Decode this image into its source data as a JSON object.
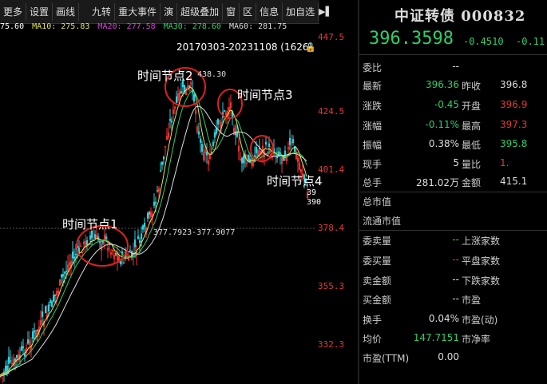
{
  "toolbar": {
    "items": [
      "更多",
      "设置",
      "画线",
      "九转",
      "重大事件",
      "演",
      "超级叠加",
      "窗",
      "区",
      "信息",
      "加自选"
    ],
    "arrow_icon": "play-forward-icon"
  },
  "ma_bar": {
    "first": "75.60",
    "ma10": "MA10: 275.83",
    "ma20": "MA20: 277.58",
    "ma30": "MA30: 278.60",
    "ma60": "MA60: 281.75",
    "colors": {
      "first": "#ffffff",
      "ma10": "#e8e84a",
      "ma20": "#e040e0",
      "ma30": "#2fcf6a",
      "ma60": "#dddddd"
    }
  },
  "chart": {
    "range": "20170303-20231108 (1626)",
    "lock_icon": "lock-icon",
    "price_ticks": [
      "447.5",
      "424.5",
      "401.4",
      "378.4",
      "355.3",
      "332.3"
    ],
    "annotations": [
      "时间节点1",
      "时间节点2",
      "时间节点3",
      "时间节点4"
    ],
    "high_label": "438.30",
    "band_label": "377.7923-377.9077",
    "end_labels": [
      "39",
      "390"
    ]
  },
  "panel": {
    "title": "中证转债 000832",
    "price": "396.3598",
    "change": "-0.4510",
    "change_pct": "-0.11",
    "rows": [
      {
        "l1": "委比",
        "v1": "--",
        "c1": "white",
        "l2": "",
        "v2": "",
        "c2": "white"
      },
      {
        "l1": "最新",
        "v1": "396.36",
        "c1": "green",
        "l2": "昨收",
        "v2": "396.8",
        "c2": "white"
      },
      {
        "l1": "涨跌",
        "v1": "-0.45",
        "c1": "green",
        "l2": "开盘",
        "v2": "396.9",
        "c2": "red"
      },
      {
        "l1": "涨幅",
        "v1": "-0.11%",
        "c1": "green",
        "l2": "最高",
        "v2": "397.3",
        "c2": "red"
      },
      {
        "l1": "振幅",
        "v1": "0.38%",
        "c1": "white",
        "l2": "最低",
        "v2": "395.8",
        "c2": "green"
      },
      {
        "l1": "现手",
        "v1": "5",
        "c1": "white",
        "l2": "量比",
        "v2": "1.",
        "c2": "red"
      },
      {
        "l1": "总手",
        "v1": "281.02万",
        "c1": "white",
        "l2": "金额",
        "v2": "415.1",
        "c2": "white"
      },
      {
        "l1": "总市值",
        "v1": "",
        "c1": "white",
        "l2": "",
        "v2": "",
        "c2": "white"
      },
      {
        "l1": "流通市值",
        "v1": "",
        "c1": "white",
        "l2": "",
        "v2": "",
        "c2": "white"
      },
      {
        "l1": "委卖量",
        "v1": "--",
        "c1": "green",
        "l2": "上涨家数",
        "v2": "",
        "c2": "white"
      },
      {
        "l1": "委买量",
        "v1": "--",
        "c1": "red",
        "l2": "平盘家数",
        "v2": "",
        "c2": "white"
      },
      {
        "l1": "卖金额",
        "v1": "--",
        "c1": "white",
        "l2": "下跌家数",
        "v2": "",
        "c2": "white"
      },
      {
        "l1": "买金额",
        "v1": "--",
        "c1": "white",
        "l2": "市盈",
        "v2": "",
        "c2": "white"
      },
      {
        "l1": "换手",
        "v1": "0.04%",
        "c1": "white",
        "l2": "市盈(动)",
        "v2": "",
        "c2": "white"
      },
      {
        "l1": "均价",
        "v1": "147.7151",
        "c1": "green",
        "l2": "市净率",
        "v2": "",
        "c2": "white"
      },
      {
        "l1": "市盈(TTM)",
        "v1": "0.00",
        "c1": "white",
        "l2": "",
        "v2": "",
        "c2": "white"
      }
    ]
  }
}
